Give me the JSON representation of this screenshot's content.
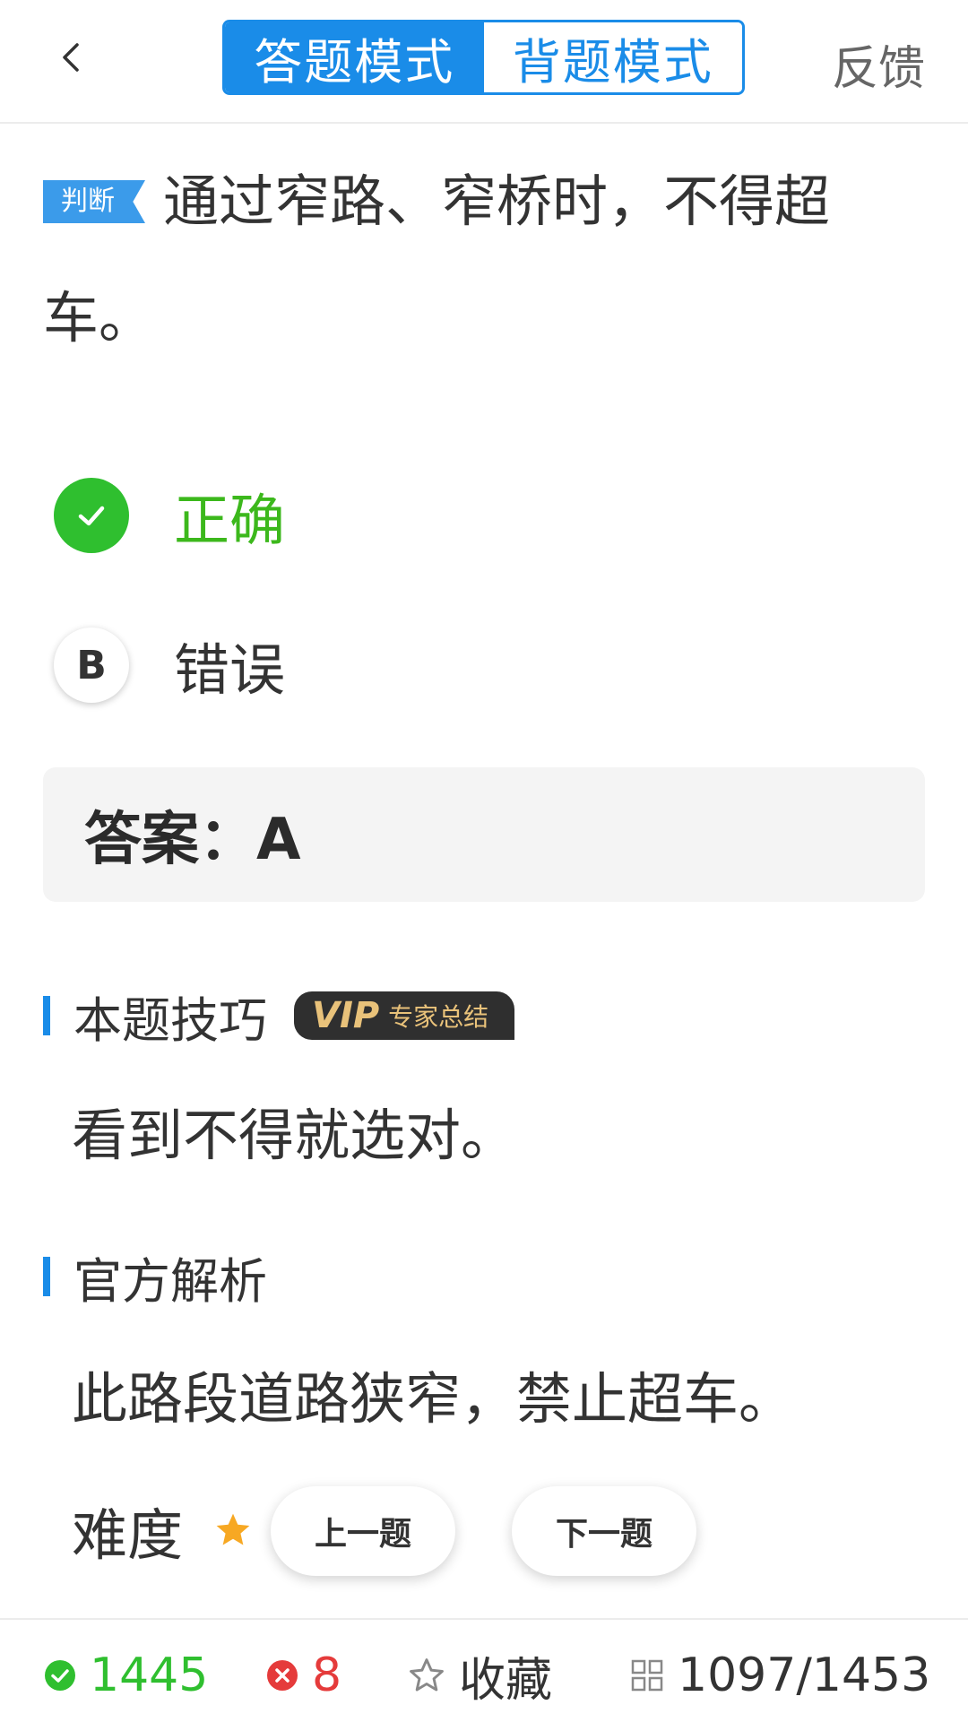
{
  "header": {
    "mode_answer": "答题模式",
    "mode_recite": "背题模式",
    "feedback": "反馈"
  },
  "question": {
    "tag": "判断",
    "text": "通过窄路、窄桥时，不得超车。"
  },
  "options": [
    {
      "label": "A",
      "text": "正确",
      "state": "correct"
    },
    {
      "label": "B",
      "text": "错误",
      "state": "plain"
    }
  ],
  "answer": {
    "text": "答案：A"
  },
  "tip": {
    "title": "本题技巧",
    "vip_word": "VIP",
    "vip_sub": "专家总结",
    "body": "看到不得就选对。"
  },
  "official": {
    "title": "官方解析",
    "body": "此路段道路狭窄，禁止超车。"
  },
  "difficulty": {
    "label": "难度"
  },
  "nav": {
    "prev": "上一题",
    "next": "下一题"
  },
  "bottom": {
    "correct_count": "1445",
    "wrong_count": "8",
    "favorite": "收藏",
    "progress": "1097/1453"
  },
  "colors": {
    "accent": "#1a8ce8",
    "correct": "#2fbf2f",
    "wrong": "#e53b3b",
    "vip_gold": "#e9c27a"
  },
  "icons": [
    "back-arrow-icon",
    "check-icon",
    "star-icon",
    "cross-icon",
    "star-outline-icon",
    "grid-icon"
  ]
}
